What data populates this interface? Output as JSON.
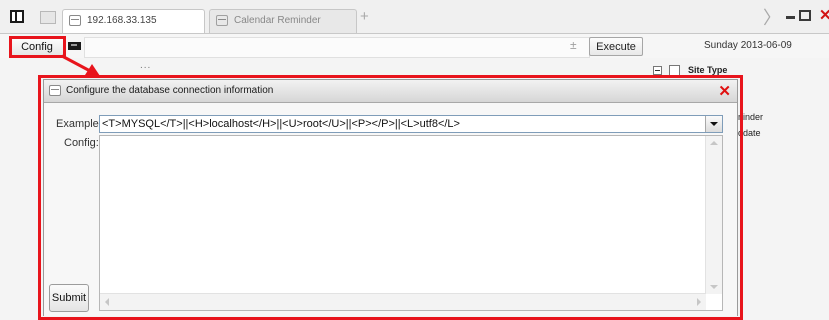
{
  "tabs": {
    "active_label": "192.168.33.135",
    "inactive_label": "Calendar Reminder"
  },
  "toolbar": {
    "config_label": "Config",
    "execute_label": "Execute",
    "expand_symbol": "±",
    "date_label": "Sunday 2013-06-09",
    "ellipsis": "..."
  },
  "sidebar": {
    "site_type_label": "Site Type",
    "partial_text_1": "ninder",
    "partial_text_2": "odate"
  },
  "modal": {
    "title": "Configure the database connection information",
    "close_symbol": "✕",
    "example_label": "Example:",
    "example_value": "<T>MYSQL</T>||<H>localhost</H>||<U>root</U>||<P></P>||<L>utf8</L>",
    "config_label": "Config:",
    "config_value": "",
    "submit_label": "Submit"
  },
  "window_controls": {
    "close_symbol": "✕",
    "chevron_symbol": "〉",
    "plus_symbol": "+"
  },
  "colors": {
    "annotation_red": "#e8141c",
    "close_red": "#e01010"
  }
}
